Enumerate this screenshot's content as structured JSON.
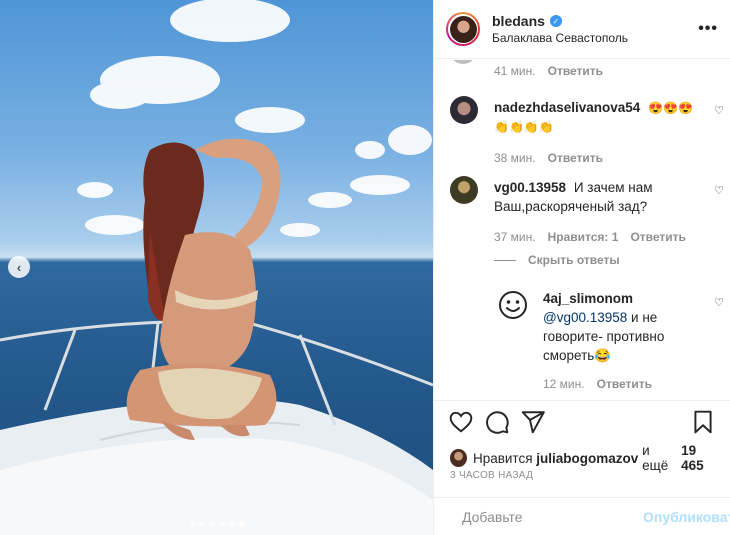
{
  "post": {
    "photo_alt": "",
    "carousel": {
      "count": 6,
      "active": 6
    }
  },
  "header": {
    "username": "bledans",
    "verified": true,
    "location": "Балаклава Севастополь",
    "more_icon": "more-horizontal-icon"
  },
  "comments": {
    "prev_meta": {
      "time": "41 мин.",
      "reply": "Ответить"
    },
    "items": [
      {
        "user": "nadezhdaselivanova54",
        "text_line1": "😍😍😍",
        "text_line2": "👏👏👏👏",
        "time": "38 мин.",
        "reply": "Ответить"
      },
      {
        "user": "vg00.13958",
        "text": "И зачем нам Ваш,раскоряченый зад?",
        "time": "37 мин.",
        "likes": "Нравится: 1",
        "reply": "Ответить"
      }
    ],
    "hide_replies": "Скрыть ответы",
    "reply": {
      "user": "4aj_slimonom",
      "mention": "@vg00.13958",
      "text": " и не говорите- противно смореть😂",
      "time": "12 мин.",
      "reply": "Ответить"
    }
  },
  "actions": {
    "likes_prefix": "Нравится",
    "likes_user": "juliabogomazov",
    "likes_mid": "и ещё",
    "likes_count": "19 465",
    "timestamp": "3 ЧАСОВ НАЗАД",
    "composer_placeholder": "Добавьте",
    "publish": "Опубликовать"
  },
  "colors": {
    "verified": "#3897f0",
    "publish_disabled": "#b2dffc",
    "muted": "#8e8e8e"
  }
}
